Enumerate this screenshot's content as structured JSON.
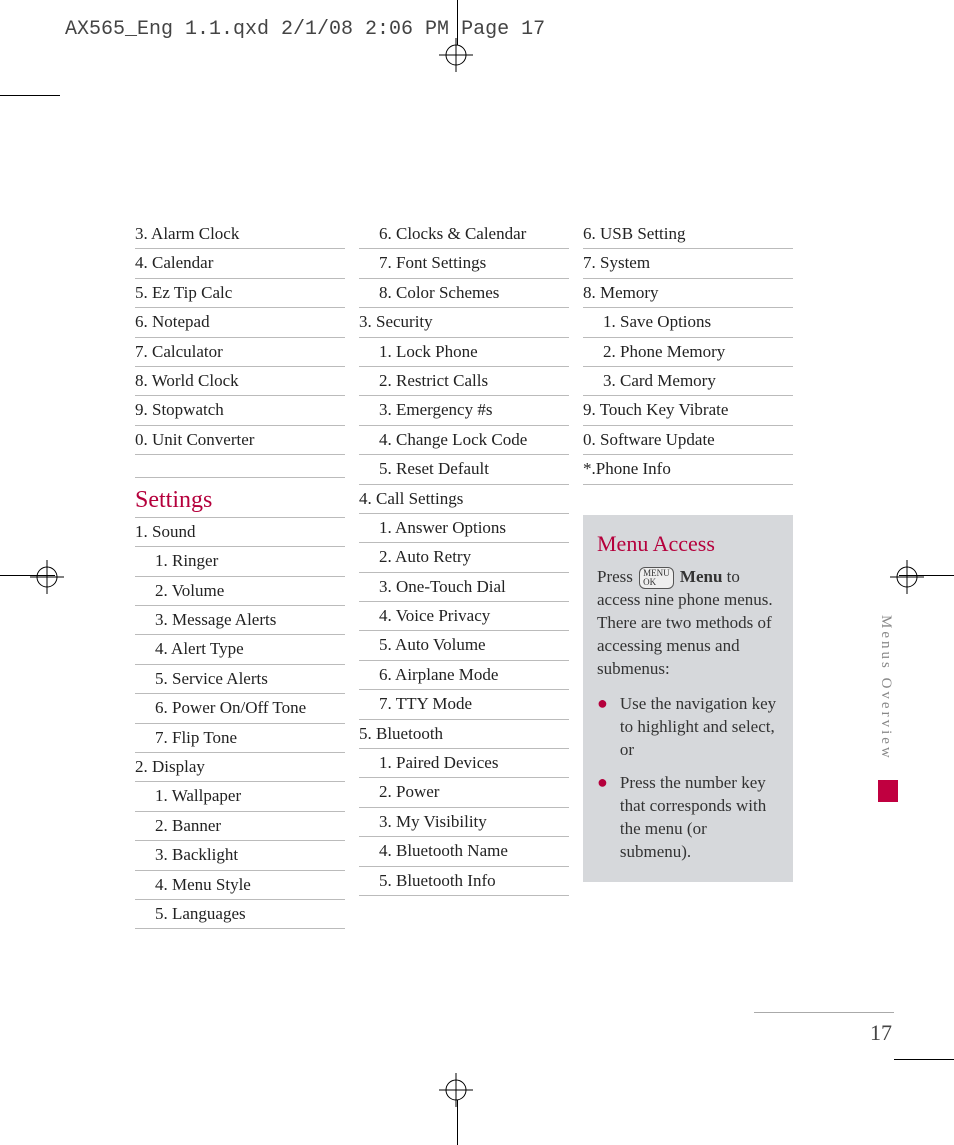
{
  "header_print": "AX565_Eng 1.1.qxd  2/1/08  2:06 PM  Page 17",
  "page_number": "17",
  "side_label": "Menus Overview",
  "col1_top": [
    "3. Alarm Clock",
    "4. Calendar",
    "5. Ez Tip Calc",
    "6. Notepad",
    "7.  Calculator",
    "8. World Clock",
    "9. Stopwatch",
    "0. Unit Converter"
  ],
  "settings_head": "Settings",
  "col1_settings": [
    {
      "t": "1. Sound",
      "s": 0
    },
    {
      "t": "1. Ringer",
      "s": 1
    },
    {
      "t": "2. Volume",
      "s": 1
    },
    {
      "t": "3. Message Alerts",
      "s": 1
    },
    {
      "t": "4. Alert Type",
      "s": 1
    },
    {
      "t": "5. Service Alerts",
      "s": 1
    },
    {
      "t": "6. Power On/Off Tone",
      "s": 1
    },
    {
      "t": "7.  Flip Tone",
      "s": 1
    },
    {
      "t": "2. Display",
      "s": 0
    },
    {
      "t": "1. Wallpaper",
      "s": 1
    },
    {
      "t": "2. Banner",
      "s": 1
    },
    {
      "t": "3. Backlight",
      "s": 1
    },
    {
      "t": "4. Menu Style",
      "s": 1
    },
    {
      "t": "5. Languages",
      "s": 1
    }
  ],
  "col2": [
    {
      "t": "6. Clocks & Calendar",
      "s": 1
    },
    {
      "t": "7.  Font Settings",
      "s": 1
    },
    {
      "t": "8. Color Schemes",
      "s": 1
    },
    {
      "t": "3. Security",
      "s": 0
    },
    {
      "t": "1. Lock Phone",
      "s": 1
    },
    {
      "t": "2. Restrict Calls",
      "s": 1
    },
    {
      "t": "3. Emergency #s",
      "s": 1
    },
    {
      "t": "4. Change Lock Code",
      "s": 1
    },
    {
      "t": "5. Reset Default",
      "s": 1
    },
    {
      "t": "4. Call Settings",
      "s": 0
    },
    {
      "t": "1. Answer Options",
      "s": 1
    },
    {
      "t": "2. Auto Retry",
      "s": 1
    },
    {
      "t": "3. One-Touch Dial",
      "s": 1
    },
    {
      "t": "4. Voice Privacy",
      "s": 1
    },
    {
      "t": "5. Auto Volume",
      "s": 1
    },
    {
      "t": "6. Airplane Mode",
      "s": 1
    },
    {
      "t": "7. TTY Mode",
      "s": 1
    },
    {
      "t": "5. Bluetooth",
      "s": 0
    },
    {
      "t": "1. Paired Devices",
      "s": 1
    },
    {
      "t": "2. Power",
      "s": 1
    },
    {
      "t": "3. My Visibility",
      "s": 1
    },
    {
      "t": "4. Bluetooth Name",
      "s": 1
    },
    {
      "t": "5. Bluetooth Info",
      "s": 1
    }
  ],
  "col3_top": [
    {
      "t": "6. USB Setting",
      "s": 0
    },
    {
      "t": "7.  System",
      "s": 0
    },
    {
      "t": "8. Memory",
      "s": 0
    },
    {
      "t": "1. Save Options",
      "s": 1
    },
    {
      "t": "2. Phone Memory",
      "s": 1
    },
    {
      "t": "3. Card Memory",
      "s": 1
    },
    {
      "t": "9. Touch Key Vibrate",
      "s": 0
    },
    {
      "t": "0. Software Update",
      "s": 0
    },
    {
      "t": "*.Phone Info",
      "s": 0
    }
  ],
  "info": {
    "title": "Menu Access",
    "body_before": "Press ",
    "body_bold": "Menu",
    "body_after": " to access nine phone menus. There are two methods of accessing menus and submenus:",
    "bullets": [
      "Use the navigation key to highlight and select, or",
      "Press the number key that corresponds with the menu (or submenu)."
    ]
  }
}
